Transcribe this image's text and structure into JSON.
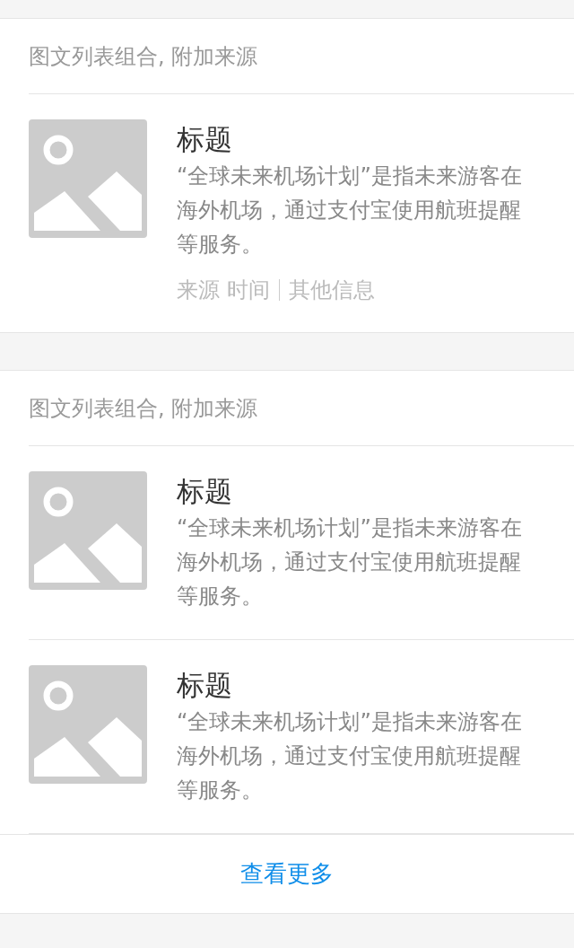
{
  "sections": [
    {
      "header": "图文列表组合, 附加来源",
      "items": [
        {
          "title": "标题",
          "description": "“全球未来机场计划”是指未来游客在海外机场，通过支付宝使用航班提醒等服务。",
          "meta": {
            "source": "来源",
            "time": "时间",
            "extra": "其他信息"
          }
        }
      ]
    },
    {
      "header": "图文列表组合, 附加来源",
      "items": [
        {
          "title": "标题",
          "description": "“全球未来机场计划”是指未来游客在海外机场，通过支付宝使用航班提醒等服务。"
        },
        {
          "title": "标题",
          "description": "“全球未来机场计划”是指未来游客在海外机场，通过支付宝使用航班提醒等服务。"
        }
      ],
      "more_link": "查看更多"
    }
  ]
}
